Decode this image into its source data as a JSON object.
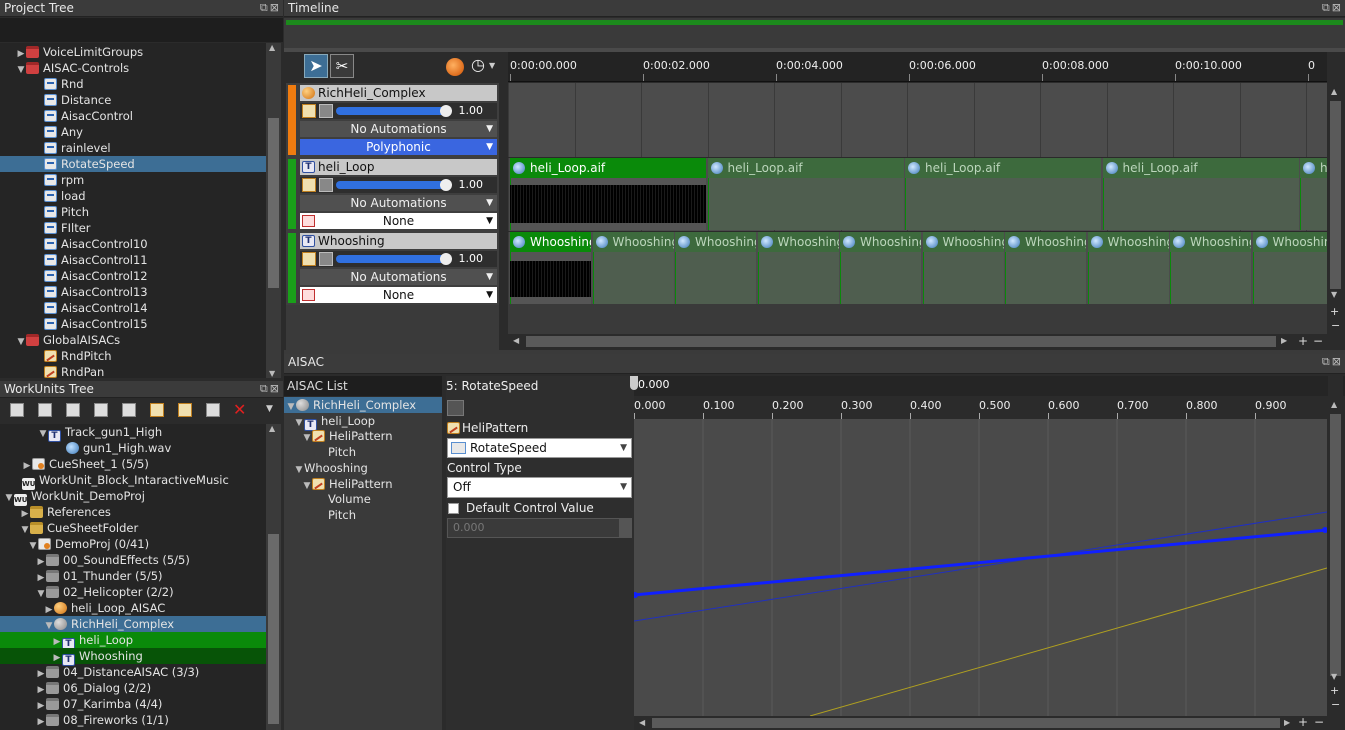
{
  "project_tree": {
    "title": "Project Tree",
    "items": [
      {
        "label": "VoiceLimitGroups",
        "icon": "red-folder-icon",
        "arrow": "▶",
        "indent": 16
      },
      {
        "label": "AISAC-Controls",
        "icon": "red-folder-icon",
        "arrow": "▼",
        "indent": 16
      },
      {
        "label": "Rnd",
        "icon": "aisac-control-icon",
        "arrow": "",
        "indent": 34
      },
      {
        "label": "Distance",
        "icon": "aisac-control-icon",
        "arrow": "",
        "indent": 34
      },
      {
        "label": "AisacControl",
        "icon": "aisac-control-icon",
        "arrow": "",
        "indent": 34
      },
      {
        "label": "Any",
        "icon": "aisac-control-icon",
        "arrow": "",
        "indent": 34
      },
      {
        "label": "rainlevel",
        "icon": "aisac-control-icon",
        "arrow": "",
        "indent": 34
      },
      {
        "label": "RotateSpeed",
        "icon": "aisac-control-icon",
        "arrow": "",
        "indent": 34,
        "selected": true
      },
      {
        "label": "rpm",
        "icon": "aisac-control-icon",
        "arrow": "",
        "indent": 34
      },
      {
        "label": "load",
        "icon": "aisac-control-icon",
        "arrow": "",
        "indent": 34
      },
      {
        "label": "Pitch",
        "icon": "aisac-control-icon",
        "arrow": "",
        "indent": 34
      },
      {
        "label": "FIlter",
        "icon": "aisac-control-icon",
        "arrow": "",
        "indent": 34
      },
      {
        "label": "AisacControl10",
        "icon": "aisac-control-icon",
        "arrow": "",
        "indent": 34
      },
      {
        "label": "AisacControl11",
        "icon": "aisac-control-icon",
        "arrow": "",
        "indent": 34
      },
      {
        "label": "AisacControl12",
        "icon": "aisac-control-icon",
        "arrow": "",
        "indent": 34
      },
      {
        "label": "AisacControl13",
        "icon": "aisac-control-icon",
        "arrow": "",
        "indent": 34
      },
      {
        "label": "AisacControl14",
        "icon": "aisac-control-icon",
        "arrow": "",
        "indent": 34
      },
      {
        "label": "AisacControl15",
        "icon": "aisac-control-icon",
        "arrow": "",
        "indent": 34
      },
      {
        "label": "GlobalAISACs",
        "icon": "red-folder-icon",
        "arrow": "▼",
        "indent": 16
      },
      {
        "label": "RndPitch",
        "icon": "aisac-curve-icon",
        "arrow": "",
        "indent": 34
      },
      {
        "label": "RndPan",
        "icon": "aisac-curve-icon",
        "arrow": "",
        "indent": 34
      }
    ]
  },
  "workunits_tree": {
    "title": "WorkUnits Tree",
    "items": [
      {
        "label": "Track_gun1_High",
        "icon": "track-icon",
        "arrow": "▼",
        "indent": 38
      },
      {
        "label": "gun1_High.wav",
        "icon": "waveform-icon",
        "arrow": "",
        "indent": 56
      },
      {
        "label": "CueSheet_1 (5/5)",
        "icon": "cuesheet-icon",
        "arrow": "▶",
        "indent": 22
      },
      {
        "label": "WorkUnit_Block_IntaractiveMusic",
        "icon": "workunit-icon",
        "arrow": "",
        "indent": 12
      },
      {
        "label": "WorkUnit_DemoProj",
        "icon": "workunit-icon",
        "arrow": "▼",
        "indent": 4
      },
      {
        "label": "References",
        "icon": "folder-icon",
        "arrow": "▶",
        "indent": 20
      },
      {
        "label": "CueSheetFolder",
        "icon": "folder-icon",
        "arrow": "▼",
        "indent": 20
      },
      {
        "label": "DemoProj (0/41)",
        "icon": "cuesheet-icon",
        "arrow": "▼",
        "indent": 28
      },
      {
        "label": "00_SoundEffects (5/5)",
        "icon": "gray-folder-icon",
        "arrow": "▶",
        "indent": 36
      },
      {
        "label": "01_Thunder (5/5)",
        "icon": "gray-folder-icon",
        "arrow": "▶",
        "indent": 36
      },
      {
        "label": "02_Helicopter (2/2)",
        "icon": "gray-folder-icon",
        "arrow": "▼",
        "indent": 36
      },
      {
        "label": "heli_Loop_AISAC",
        "icon": "cue-icon",
        "arrow": "▶",
        "indent": 44
      },
      {
        "label": "RichHeli_Complex",
        "icon": "cue-gray-icon",
        "arrow": "▼",
        "indent": 44,
        "selected": "blue"
      },
      {
        "label": "heli_Loop",
        "icon": "track-icon",
        "arrow": "▶",
        "indent": 52,
        "selected": "green"
      },
      {
        "label": "Whooshing",
        "icon": "track-icon",
        "arrow": "▶",
        "indent": 52,
        "selected": "darkgreen"
      },
      {
        "label": "04_DistanceAISAC (3/3)",
        "icon": "gray-folder-icon",
        "arrow": "▶",
        "indent": 36
      },
      {
        "label": "06_Dialog (2/2)",
        "icon": "gray-folder-icon",
        "arrow": "▶",
        "indent": 36
      },
      {
        "label": "07_Karimba (4/4)",
        "icon": "gray-folder-icon",
        "arrow": "▶",
        "indent": 36
      },
      {
        "label": "08_Fireworks (1/1)",
        "icon": "gray-folder-icon",
        "arrow": "▶",
        "indent": 36
      }
    ]
  },
  "timeline": {
    "title": "Timeline",
    "ruler": [
      "0:00:00.000",
      "0:00:02.000",
      "0:00:04.000",
      "0:00:06.000",
      "0:00:08.000",
      "0:00:10.000",
      "0"
    ],
    "tracks": [
      {
        "name": "RichHeli_Complex",
        "volume": "1.00",
        "automation": "No Automations",
        "mode": "Polyphonic",
        "color": "#f07c10"
      },
      {
        "name": "heli_Loop",
        "volume": "1.00",
        "automation": "No Automations",
        "mode": "None",
        "color": "#1aa01a"
      },
      {
        "name": "Whooshing",
        "volume": "1.00",
        "automation": "No Automations",
        "mode": "None",
        "color": "#1aa01a"
      }
    ],
    "heli_clips": [
      "heli_Loop.aif",
      "heli_Loop.aif",
      "heli_Loop.aif",
      "heli_Loop.aif",
      "h"
    ],
    "whoosh_clips": [
      "Whooshing",
      "Whooshing",
      "Whooshing",
      "Whooshing",
      "Whooshing",
      "Whooshing",
      "Whooshing",
      "Whooshing",
      "Whooshing",
      "Whooshin"
    ]
  },
  "aisac": {
    "title": "AISAC",
    "list_title": "AISAC List",
    "list_items": [
      {
        "label": "RichHeli_Complex",
        "icon": "cue-gray-icon",
        "arrow": "▼",
        "indent": 2,
        "selected": true
      },
      {
        "label": "heli_Loop",
        "icon": "track-icon",
        "arrow": "▼",
        "indent": 10
      },
      {
        "label": "HeliPattern",
        "icon": "aisac-curve-icon",
        "arrow": "▼",
        "indent": 18
      },
      {
        "label": "Pitch",
        "icon": "",
        "arrow": "",
        "indent": 34
      },
      {
        "label": "Whooshing",
        "icon": "",
        "arrow": "▼",
        "indent": 10
      },
      {
        "label": "HeliPattern",
        "icon": "aisac-curve-icon",
        "arrow": "▼",
        "indent": 18
      },
      {
        "label": "Volume",
        "icon": "",
        "arrow": "",
        "indent": 34
      },
      {
        "label": "Pitch",
        "icon": "",
        "arrow": "",
        "indent": 34
      }
    ],
    "control_title": "5: RotateSpeed",
    "pattern_label": "HeliPattern",
    "control_select": "RotateSpeed",
    "control_type_label": "Control Type",
    "control_type_value": "Off",
    "default_value_label": "Default Control Value",
    "default_value": "0.000",
    "cursor_value": "0.000",
    "graph_ruler": [
      "0.000",
      "0.100",
      "0.200",
      "0.300",
      "0.400",
      "0.500",
      "0.600",
      "0.700",
      "0.800",
      "0.900"
    ]
  },
  "colors": {
    "selection_blue": "#3d6e95",
    "clip_green": "#0a8a0a",
    "curve_blue": "#1020ff",
    "curve_yellow": "#b0a020"
  }
}
